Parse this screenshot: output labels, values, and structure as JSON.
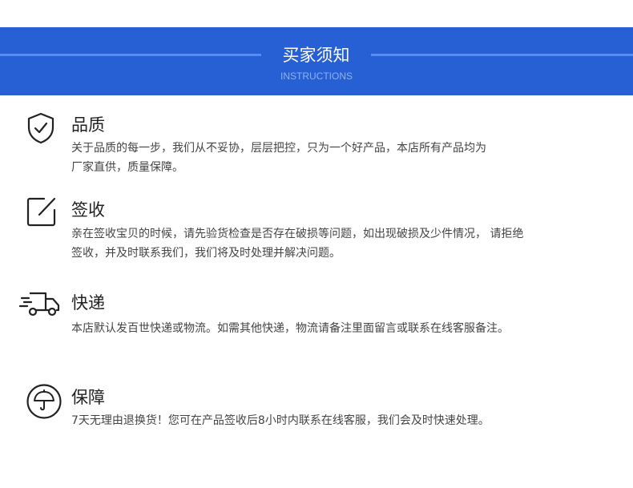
{
  "header": {
    "title": "买家须知",
    "subtitle": "INSTRUCTIONS"
  },
  "sections": [
    {
      "icon": "shield-check-icon",
      "title": "品质",
      "line1": "关于品质的每一步，我们从不妥协，层层把控，只为一个好产品，本店所有产品均为",
      "line2": "厂家直供，质量保障。"
    },
    {
      "icon": "edit-square-icon",
      "title": "签收",
      "line1": "亲在签收宝贝的时候，请先验货检查是否存在破损等问题，如出现破损及少件情况， 请拒绝",
      "line2": "签收，并及时联系我们，我们将及时处理并解决问题。"
    },
    {
      "icon": "delivery-truck-icon",
      "title": "快递",
      "line1": "本店默认发百世快递或物流。如需其他快递，物流请备注里面留言或联系在线客服备注。"
    },
    {
      "icon": "umbrella-icon",
      "title": "保障",
      "line1": "7天无理由退换货！您可在产品签收后8小时内联系在线客服，我们会及时快速处理。"
    }
  ]
}
